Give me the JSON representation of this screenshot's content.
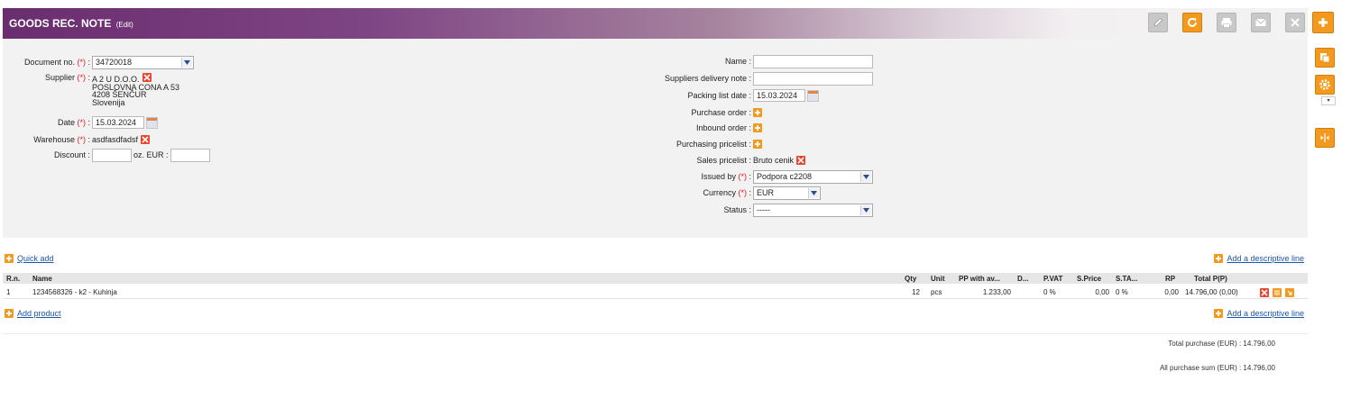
{
  "header": {
    "title": "GOODS REC. NOTE",
    "subtitle": "(Edit)"
  },
  "toolbar": {
    "buttons": [
      {
        "icon": "pencil-icon",
        "label": "Edit"
      },
      {
        "icon": "refresh-icon",
        "label": "Refresh"
      },
      {
        "icon": "print-icon",
        "label": "Print"
      },
      {
        "icon": "mail-icon",
        "label": "Email"
      },
      {
        "icon": "close-icon",
        "label": "Close"
      },
      {
        "icon": "plus-icon",
        "label": "New"
      }
    ]
  },
  "form": {
    "required_marker": "(*)",
    "document_no": {
      "label": "Document no.",
      "value": "34720018"
    },
    "supplier": {
      "label": "Supplier",
      "lines": [
        "A 2 U D.O.O.",
        "POSLOVNA CONA A 53",
        "4208 ŠENČUR",
        "Slovenija"
      ]
    },
    "date": {
      "label": "Date",
      "value": "15.03.2024"
    },
    "warehouse": {
      "label": "Warehouse",
      "value": "asdfasdfadsf"
    },
    "discount": {
      "label": "Discount :",
      "value": "",
      "eur_label": "oz. EUR :",
      "eur_value": ""
    },
    "name": {
      "label": "Name :",
      "value": ""
    },
    "suppliers_delivery_note": {
      "label": "Suppliers delivery note :",
      "value": ""
    },
    "packing_list_date": {
      "label": "Packing list date :",
      "value": "15.03.2024"
    },
    "purchase_order": {
      "label": "Purchase order :"
    },
    "inbound_order": {
      "label": "Inbound order :"
    },
    "purchasing_pricelist": {
      "label": "Purchasing pricelist :"
    },
    "sales_pricelist": {
      "label": "Sales pricelist :",
      "value": "Bruto cenik"
    },
    "issued_by": {
      "label": "Issued by",
      "value": "Podpora c2208"
    },
    "currency": {
      "label": "Currency",
      "value": "EUR"
    },
    "status": {
      "label": "Status :",
      "value": "-----"
    }
  },
  "lines": {
    "quick_add": "Quick add",
    "add_descriptive_line": "Add a descriptive line",
    "add_product": "Add product",
    "columns": [
      "R.n.",
      "Name",
      "Qty",
      "Unit",
      "PP with av...",
      "D...",
      "P.VAT",
      "S.Price",
      "S.TA...",
      "RP",
      "Total P(P)"
    ],
    "rows": [
      {
        "rn": "1",
        "name": "1234568326 - k2 - Kuhinja",
        "qty": "12",
        "unit": "pcs",
        "pp": "1.233,00",
        "d": "",
        "pvat": "0 %",
        "sprice": "0,00",
        "sta": "0 %",
        "rp": "0,00",
        "total": "14.796,00 (0,00)"
      }
    ]
  },
  "totals": {
    "total_purchase": "Total purchase (EUR) : 14.796,00",
    "all_purchase_sum": "All purchase sum (EUR) : 14.796,00"
  },
  "colors": {
    "header_start": "#6a2d6f",
    "accent_orange": "#f39a1e",
    "delete_red": "#e8452c",
    "link_blue": "#1a57a8",
    "required_red": "#e02020"
  }
}
